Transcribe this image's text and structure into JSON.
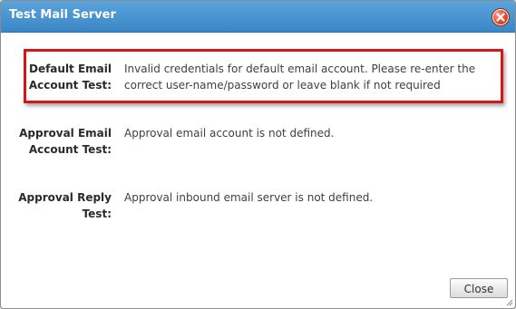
{
  "dialog": {
    "title": "Test Mail Server",
    "tests": [
      {
        "label": "Default Email Account Test:",
        "message": "Invalid credentials for default email account. Please re-enter the correct user-name/password or leave blank if not required"
      },
      {
        "label": "Approval Email Account Test:",
        "message": "Approval email account is not defined."
      },
      {
        "label": "Approval Reply Test:",
        "message": "Approval inbound email server is not defined."
      }
    ],
    "close_label": "Close"
  },
  "colors": {
    "titlebar": "#3b86c6",
    "highlight": "#d61616",
    "close_icon": "#d9401e"
  },
  "icons": {
    "close": "close-icon",
    "resize": "resize-grip-icon"
  }
}
